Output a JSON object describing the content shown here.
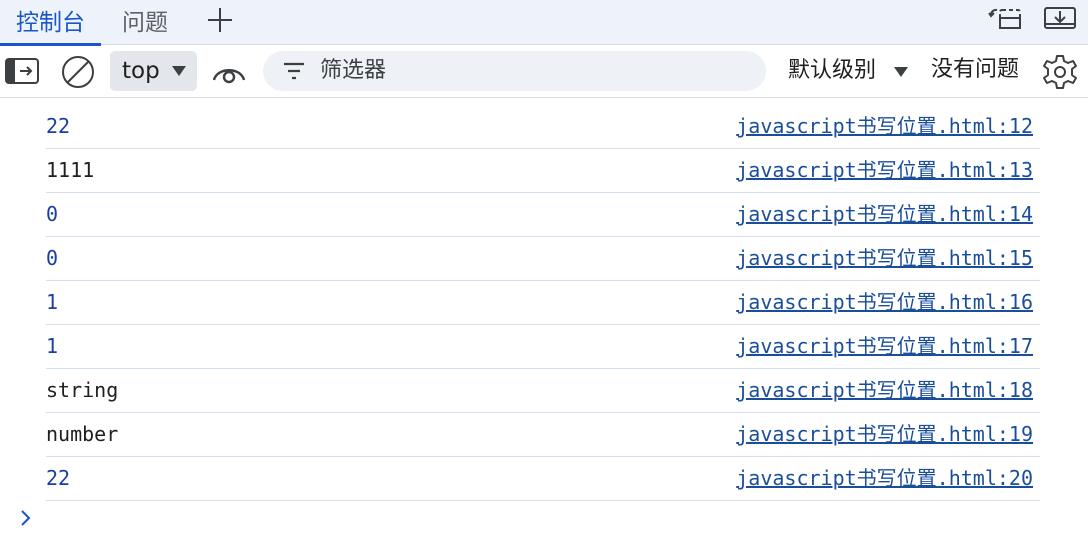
{
  "tabs": {
    "console": "控制台",
    "issues": "问题"
  },
  "toolbar": {
    "context": "top",
    "filter_placeholder": "筛选器",
    "levels": "默认级别",
    "issues_status": "没有问题"
  },
  "icons": {
    "add_tab": "plus-icon",
    "dock": "dock-side-icon",
    "undock": "undock-icon",
    "sidebar": "sidebar-toggle-icon",
    "clear": "clear-console-icon",
    "live_expression": "eye-icon",
    "filter": "filter-icon",
    "settings": "gear-icon",
    "prompt": "chevron-right-icon"
  },
  "colors": {
    "accent": "#1a56c6",
    "number": "#1a3fa0",
    "link": "#1a4e9a"
  },
  "messages": [
    {
      "value": "22",
      "type": "number",
      "source": "javascript书写位置.html:12"
    },
    {
      "value": "1111",
      "type": "string",
      "source": "javascript书写位置.html:13"
    },
    {
      "value": "0",
      "type": "number",
      "source": "javascript书写位置.html:14"
    },
    {
      "value": "0",
      "type": "number",
      "source": "javascript书写位置.html:15"
    },
    {
      "value": "1",
      "type": "number",
      "source": "javascript书写位置.html:16"
    },
    {
      "value": "1",
      "type": "number",
      "source": "javascript书写位置.html:17"
    },
    {
      "value": "string",
      "type": "string",
      "source": "javascript书写位置.html:18"
    },
    {
      "value": "number",
      "type": "string",
      "source": "javascript书写位置.html:19"
    },
    {
      "value": "22",
      "type": "number",
      "source": "javascript书写位置.html:20"
    }
  ]
}
